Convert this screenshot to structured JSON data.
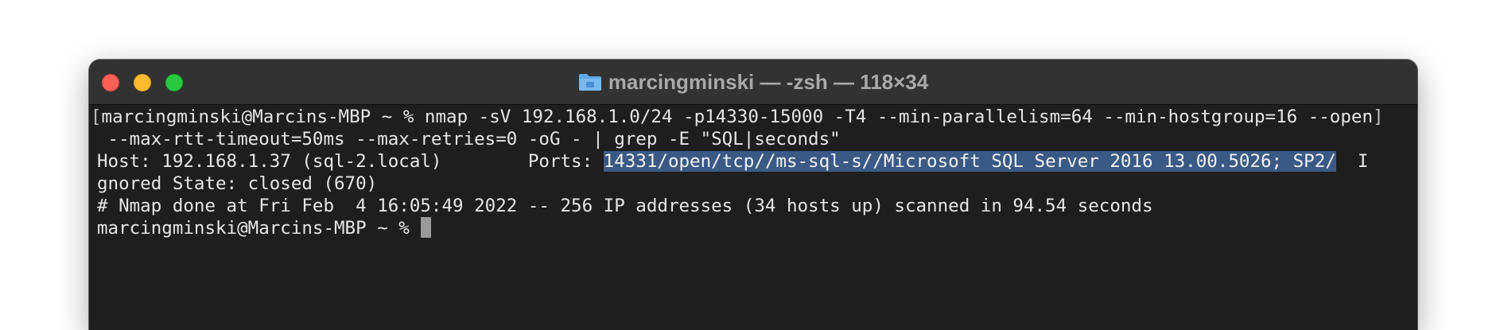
{
  "window": {
    "title": "marcingminski — -zsh — 118×34",
    "title_icon": "folder-icon",
    "traffic_lights": {
      "close_color": "#fe5f57",
      "minimize_color": "#febc2e",
      "zoom_color": "#28c840"
    }
  },
  "terminal": {
    "lines": [
      {
        "prefix": "[",
        "text": "marcingminski@Marcins-MBP ~ % nmap -sV 192.168.1.0/24 -p14330-15000 -T4 --min-parallelism=64 --min-hostgroup=16 --open",
        "suffix": "]"
      },
      {
        "text": " --max-rtt-timeout=50ms --max-retries=0 -oG - | grep -E \"SQL|seconds\""
      },
      {
        "before": "Host: 192.168.1.37 (sql-2.local)        Ports: ",
        "selected": "14331/open/tcp//ms-sql-s//Microsoft SQL Server 2016 13.00.5026; SP2/",
        "after": "  I"
      },
      {
        "text": "gnored State: closed (670)"
      },
      {
        "text": "# Nmap done at Fri Feb  4 16:05:49 2022 -- 256 IP addresses (34 hosts up) scanned in 94.54 seconds"
      },
      {
        "text": "marcingminski@Marcins-MBP ~ % "
      }
    ],
    "selection_color": "#3a5a85",
    "background_color": "#1e1e1e"
  }
}
